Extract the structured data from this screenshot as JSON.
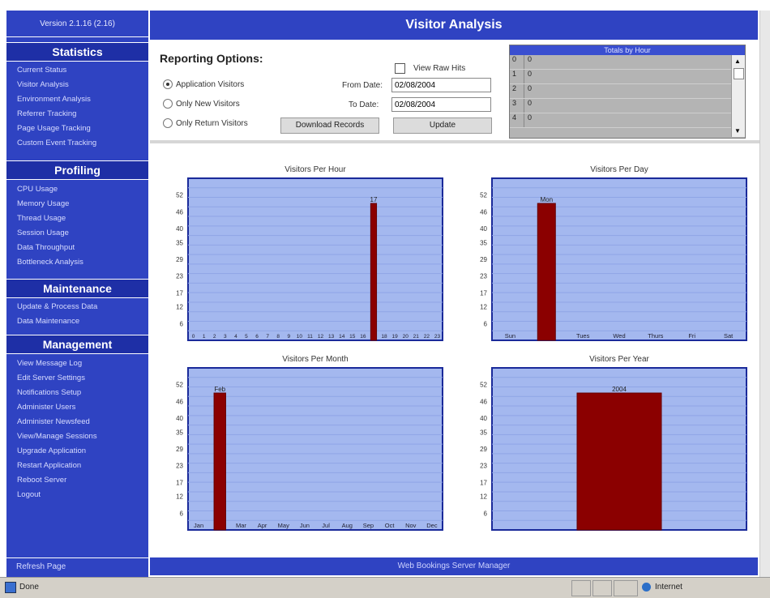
{
  "sidebar": {
    "version": "Version 2.1.16 (2.16)",
    "sections": [
      {
        "title": "Statistics",
        "items": [
          "Current Status",
          "Visitor Analysis",
          "Environment Analysis",
          "Referrer Tracking",
          "Page Usage Tracking",
          "Custom Event Tracking"
        ]
      },
      {
        "title": "Profiling",
        "items": [
          "CPU Usage",
          "Memory Usage",
          "Thread Usage",
          "Session Usage",
          "Data Throughput",
          "Bottleneck Analysis"
        ]
      },
      {
        "title": "Maintenance",
        "items": [
          "Update & Process Data",
          "Data Maintenance"
        ]
      },
      {
        "title": "Management",
        "items": [
          "View Message Log",
          "Edit Server Settings",
          "Notifications Setup",
          "Administer Users",
          "Administer Newsfeed",
          "View/Manage Sessions",
          "Upgrade Application",
          "Restart Application",
          "Reboot Server",
          "Logout"
        ]
      }
    ],
    "refresh_label": "Refresh Page"
  },
  "header": {
    "title": "Visitor Analysis"
  },
  "options": {
    "title": "Reporting Options:",
    "radios": [
      {
        "label": "Application Visitors",
        "checked": true
      },
      {
        "label": "Only New Visitors",
        "checked": false
      },
      {
        "label": "Only Return Visitors",
        "checked": false
      }
    ],
    "view_raw_hits_label": "View Raw Hits",
    "from_label": "From Date:",
    "from_value": "02/08/2004",
    "to_label": "To Date:",
    "to_value": "02/08/2004",
    "download_label": "Download Records",
    "update_label": "Update"
  },
  "totals": {
    "title": "Totals by Hour",
    "rows": [
      [
        "0",
        "0"
      ],
      [
        "1",
        "0"
      ],
      [
        "2",
        "0"
      ],
      [
        "3",
        "0"
      ],
      [
        "4",
        "0"
      ]
    ]
  },
  "footer": {
    "label": "Web Bookings Server Manager"
  },
  "statusbar": {
    "left": "Done",
    "zone": "Internet"
  },
  "chart_data": [
    {
      "type": "bar",
      "title": "Visitors Per Hour",
      "yticks": [
        6,
        12,
        17,
        23,
        29,
        35,
        40,
        46,
        52
      ],
      "ylim": [
        0,
        58
      ],
      "categories": [
        "0",
        "1",
        "2",
        "3",
        "4",
        "5",
        "6",
        "7",
        "8",
        "9",
        "10",
        "11",
        "12",
        "13",
        "14",
        "15",
        "16",
        "17",
        "18",
        "19",
        "20",
        "21",
        "22",
        "23"
      ],
      "values": [
        0,
        0,
        0,
        0,
        0,
        0,
        0,
        0,
        0,
        0,
        0,
        0,
        0,
        0,
        0,
        0,
        0,
        49,
        0,
        0,
        0,
        0,
        0,
        0
      ],
      "labels": {
        "17": "17"
      }
    },
    {
      "type": "bar",
      "title": "Visitors Per Day",
      "yticks": [
        6,
        12,
        17,
        23,
        29,
        35,
        40,
        46,
        52
      ],
      "ylim": [
        0,
        58
      ],
      "categories": [
        "Sun",
        "Mon",
        "Tues",
        "Wed",
        "Thurs",
        "Fri",
        "Sat"
      ],
      "values": [
        0,
        49,
        0,
        0,
        0,
        0,
        0
      ],
      "labels": {
        "1": "Mon"
      }
    },
    {
      "type": "bar",
      "title": "Visitors Per Month",
      "yticks": [
        6,
        12,
        17,
        23,
        29,
        35,
        40,
        46,
        52
      ],
      "ylim": [
        0,
        58
      ],
      "categories": [
        "Jan",
        "Feb",
        "Mar",
        "Apr",
        "May",
        "Jun",
        "Jul",
        "Aug",
        "Sep",
        "Oct",
        "Nov",
        "Dec"
      ],
      "values": [
        0,
        49,
        0,
        0,
        0,
        0,
        0,
        0,
        0,
        0,
        0,
        0
      ],
      "labels": {
        "1": "Feb"
      }
    },
    {
      "type": "bar",
      "title": "Visitors Per Year",
      "yticks": [
        6,
        12,
        17,
        23,
        29,
        35,
        40,
        46,
        52
      ],
      "ylim": [
        0,
        58
      ],
      "categories": [
        "2004"
      ],
      "values": [
        49
      ],
      "labels": {
        "0": "2004"
      }
    }
  ],
  "colors": {
    "plot_bg": "#a4b8ef",
    "bar": "#8b0000",
    "frame": "#1a2a9a",
    "grid": "#8fa5e6"
  }
}
